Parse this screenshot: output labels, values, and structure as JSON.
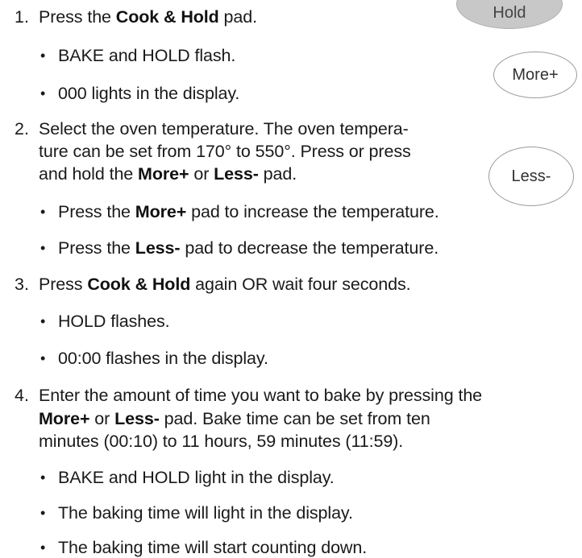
{
  "pads": {
    "hold": "Hold",
    "more": "More+",
    "less": "Less-"
  },
  "steps": [
    {
      "number": "1.",
      "lines": [
        {
          "pre": "Press the ",
          "bold": "Cook & Hold",
          "post": " pad."
        }
      ],
      "bullets": [
        "BAKE and HOLD flash.",
        "000 lights in the display."
      ]
    },
    {
      "number": "2.",
      "lines": [
        {
          "pre": "Select the oven temperature.  The oven tempera-",
          "bold": "",
          "post": ""
        },
        {
          "pre": "ture can be set from 170° to 550°.  Press or press",
          "bold": "",
          "post": ""
        },
        {
          "pre": "and hold the ",
          "bold": "More+",
          "mid": " or ",
          "bold2": "Less-",
          "post": " pad."
        }
      ],
      "bullets": [
        {
          "pre": "Press the ",
          "bold": "More+",
          "post": " pad to increase the temperature."
        },
        {
          "pre": "Press the ",
          "bold": "Less-",
          "post": " pad to decrease the temperature."
        }
      ]
    },
    {
      "number": "3.",
      "lines": [
        {
          "pre": "Press ",
          "bold": "Cook & Hold",
          "post": " again OR wait four seconds."
        }
      ],
      "bullets": [
        "HOLD flashes.",
        "00:00 flashes in the display."
      ]
    },
    {
      "number": "4.",
      "lines": [
        {
          "pre": "Enter the amount of time you want to bake by pressing the",
          "bold": "",
          "post": ""
        },
        {
          "pre": "",
          "bold": "More+",
          "mid": " or ",
          "bold2": "Less-",
          "post": " pad.  Bake time can be set from ten"
        },
        {
          "pre": "minutes (00:10) to 11 hours, 59 minutes (11:59).",
          "bold": "",
          "post": ""
        }
      ],
      "bullets": [
        "BAKE and HOLD light in the display.",
        "The baking time will light in the display.",
        "The baking time will start counting down."
      ]
    }
  ]
}
